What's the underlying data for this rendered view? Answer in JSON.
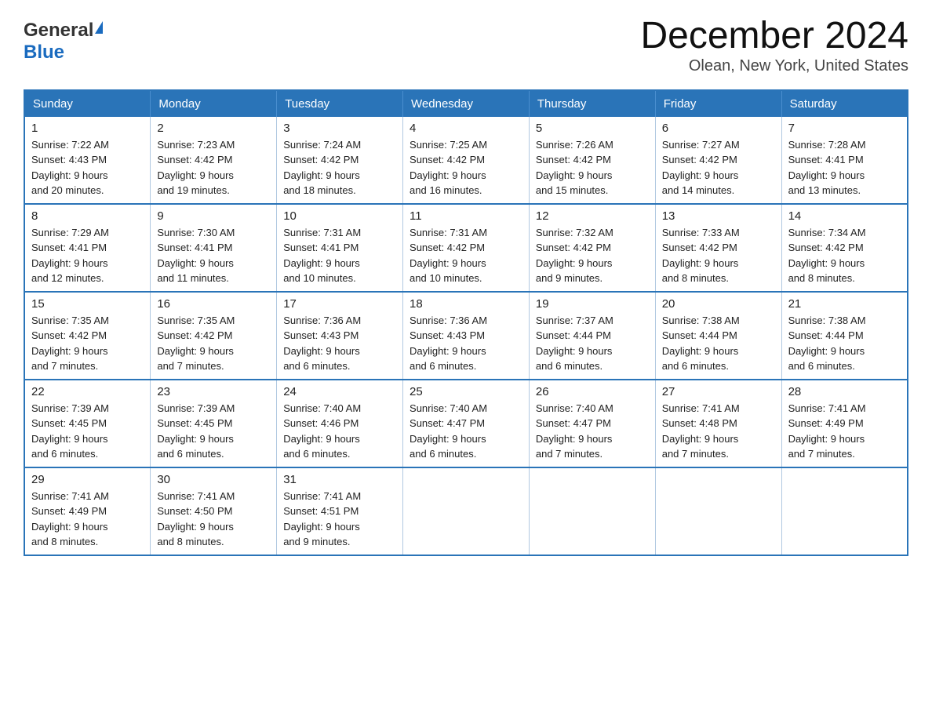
{
  "header": {
    "title": "December 2024",
    "subtitle": "Olean, New York, United States",
    "logo_general": "General",
    "logo_blue": "Blue"
  },
  "weekdays": [
    "Sunday",
    "Monday",
    "Tuesday",
    "Wednesday",
    "Thursday",
    "Friday",
    "Saturday"
  ],
  "weeks": [
    [
      {
        "day": "1",
        "sunrise": "7:22 AM",
        "sunset": "4:43 PM",
        "daylight": "9 hours and 20 minutes."
      },
      {
        "day": "2",
        "sunrise": "7:23 AM",
        "sunset": "4:42 PM",
        "daylight": "9 hours and 19 minutes."
      },
      {
        "day": "3",
        "sunrise": "7:24 AM",
        "sunset": "4:42 PM",
        "daylight": "9 hours and 18 minutes."
      },
      {
        "day": "4",
        "sunrise": "7:25 AM",
        "sunset": "4:42 PM",
        "daylight": "9 hours and 16 minutes."
      },
      {
        "day": "5",
        "sunrise": "7:26 AM",
        "sunset": "4:42 PM",
        "daylight": "9 hours and 15 minutes."
      },
      {
        "day": "6",
        "sunrise": "7:27 AM",
        "sunset": "4:42 PM",
        "daylight": "9 hours and 14 minutes."
      },
      {
        "day": "7",
        "sunrise": "7:28 AM",
        "sunset": "4:41 PM",
        "daylight": "9 hours and 13 minutes."
      }
    ],
    [
      {
        "day": "8",
        "sunrise": "7:29 AM",
        "sunset": "4:41 PM",
        "daylight": "9 hours and 12 minutes."
      },
      {
        "day": "9",
        "sunrise": "7:30 AM",
        "sunset": "4:41 PM",
        "daylight": "9 hours and 11 minutes."
      },
      {
        "day": "10",
        "sunrise": "7:31 AM",
        "sunset": "4:41 PM",
        "daylight": "9 hours and 10 minutes."
      },
      {
        "day": "11",
        "sunrise": "7:31 AM",
        "sunset": "4:42 PM",
        "daylight": "9 hours and 10 minutes."
      },
      {
        "day": "12",
        "sunrise": "7:32 AM",
        "sunset": "4:42 PM",
        "daylight": "9 hours and 9 minutes."
      },
      {
        "day": "13",
        "sunrise": "7:33 AM",
        "sunset": "4:42 PM",
        "daylight": "9 hours and 8 minutes."
      },
      {
        "day": "14",
        "sunrise": "7:34 AM",
        "sunset": "4:42 PM",
        "daylight": "9 hours and 8 minutes."
      }
    ],
    [
      {
        "day": "15",
        "sunrise": "7:35 AM",
        "sunset": "4:42 PM",
        "daylight": "9 hours and 7 minutes."
      },
      {
        "day": "16",
        "sunrise": "7:35 AM",
        "sunset": "4:42 PM",
        "daylight": "9 hours and 7 minutes."
      },
      {
        "day": "17",
        "sunrise": "7:36 AM",
        "sunset": "4:43 PM",
        "daylight": "9 hours and 6 minutes."
      },
      {
        "day": "18",
        "sunrise": "7:36 AM",
        "sunset": "4:43 PM",
        "daylight": "9 hours and 6 minutes."
      },
      {
        "day": "19",
        "sunrise": "7:37 AM",
        "sunset": "4:44 PM",
        "daylight": "9 hours and 6 minutes."
      },
      {
        "day": "20",
        "sunrise": "7:38 AM",
        "sunset": "4:44 PM",
        "daylight": "9 hours and 6 minutes."
      },
      {
        "day": "21",
        "sunrise": "7:38 AM",
        "sunset": "4:44 PM",
        "daylight": "9 hours and 6 minutes."
      }
    ],
    [
      {
        "day": "22",
        "sunrise": "7:39 AM",
        "sunset": "4:45 PM",
        "daylight": "9 hours and 6 minutes."
      },
      {
        "day": "23",
        "sunrise": "7:39 AM",
        "sunset": "4:45 PM",
        "daylight": "9 hours and 6 minutes."
      },
      {
        "day": "24",
        "sunrise": "7:40 AM",
        "sunset": "4:46 PM",
        "daylight": "9 hours and 6 minutes."
      },
      {
        "day": "25",
        "sunrise": "7:40 AM",
        "sunset": "4:47 PM",
        "daylight": "9 hours and 6 minutes."
      },
      {
        "day": "26",
        "sunrise": "7:40 AM",
        "sunset": "4:47 PM",
        "daylight": "9 hours and 7 minutes."
      },
      {
        "day": "27",
        "sunrise": "7:41 AM",
        "sunset": "4:48 PM",
        "daylight": "9 hours and 7 minutes."
      },
      {
        "day": "28",
        "sunrise": "7:41 AM",
        "sunset": "4:49 PM",
        "daylight": "9 hours and 7 minutes."
      }
    ],
    [
      {
        "day": "29",
        "sunrise": "7:41 AM",
        "sunset": "4:49 PM",
        "daylight": "9 hours and 8 minutes."
      },
      {
        "day": "30",
        "sunrise": "7:41 AM",
        "sunset": "4:50 PM",
        "daylight": "9 hours and 8 minutes."
      },
      {
        "day": "31",
        "sunrise": "7:41 AM",
        "sunset": "4:51 PM",
        "daylight": "9 hours and 9 minutes."
      },
      null,
      null,
      null,
      null
    ]
  ],
  "labels": {
    "sunrise": "Sunrise:",
    "sunset": "Sunset:",
    "daylight": "Daylight:"
  }
}
